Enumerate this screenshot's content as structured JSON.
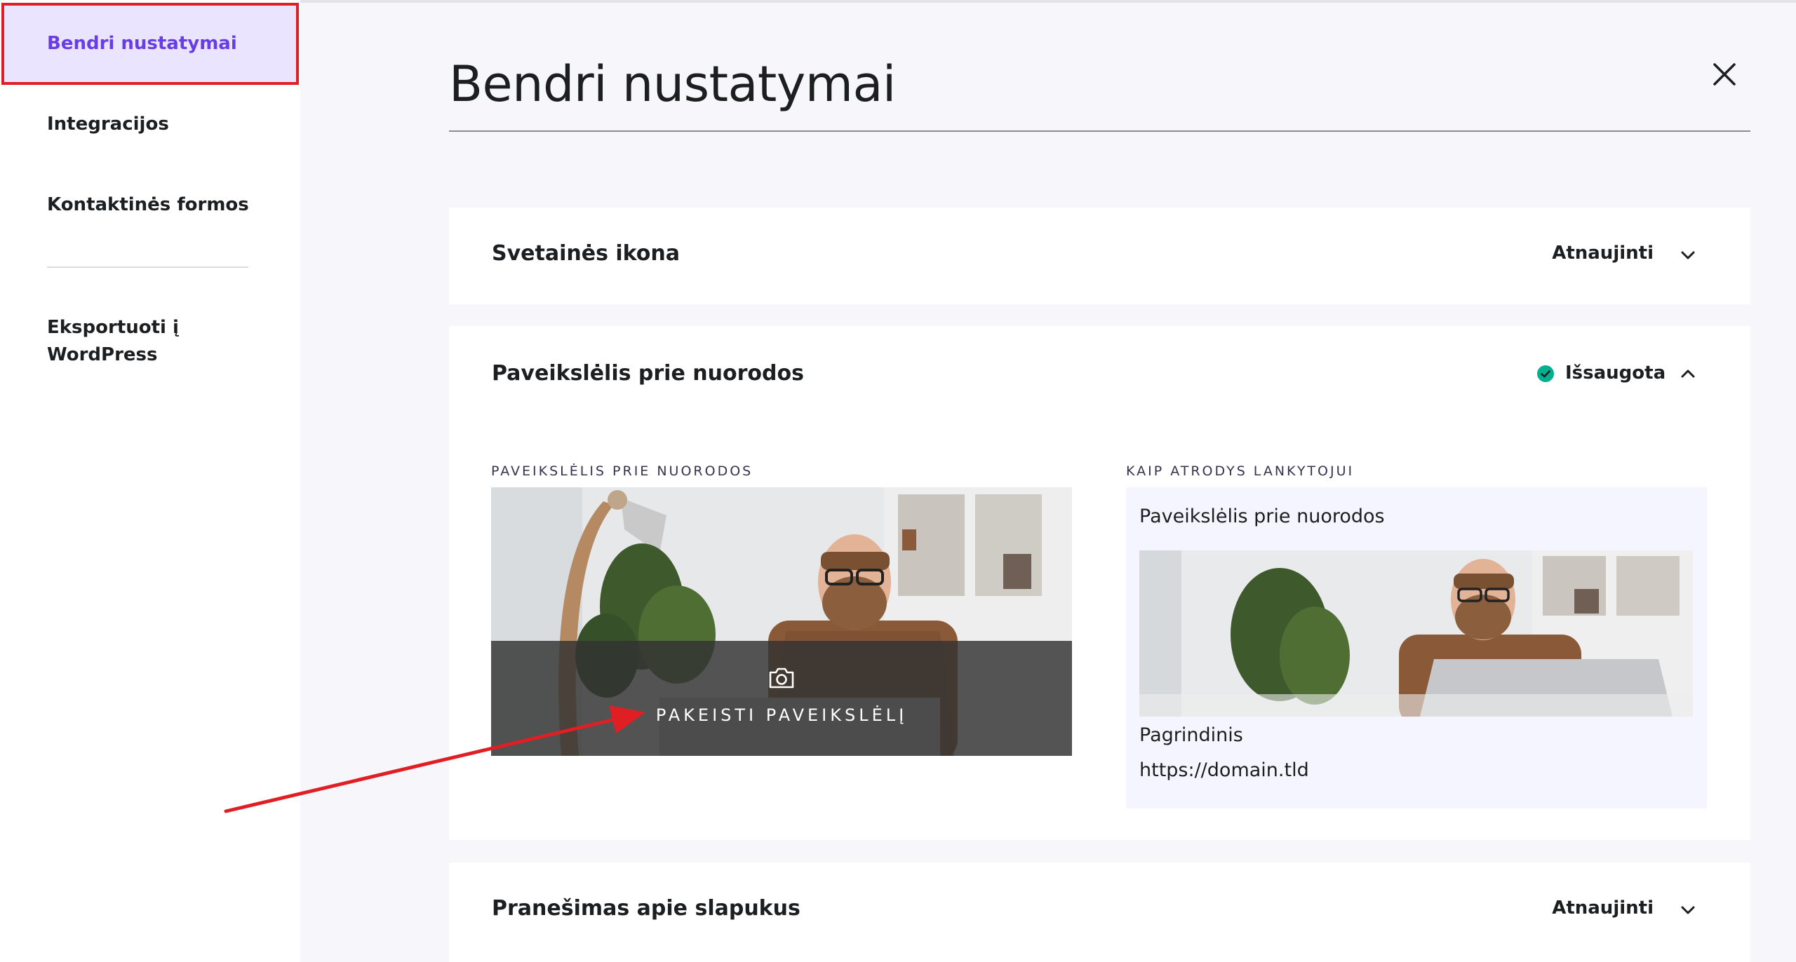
{
  "sidebar": {
    "items": [
      {
        "label": "Bendri nustatymai"
      },
      {
        "label": "Integracijos"
      },
      {
        "label": "Kontaktinės formos"
      },
      {
        "label": "Eksportuoti į"
      },
      {
        "label": "WordPress"
      }
    ]
  },
  "main": {
    "title": "Bendri nustatymai",
    "sections": {
      "site_icon": {
        "title": "Svetainės ikona",
        "action": "Atnaujinti"
      },
      "link_image": {
        "title": "Paveikslėlis prie nuorodos",
        "status": "Išsaugota",
        "image_label": "PAVEIKSLĖLIS PRIE NUORODOS",
        "change_button": "PAKEISTI PAVEIKSLĖLĮ",
        "preview_label": "KAIP ATRODYS LANKYTOJUI",
        "preview": {
          "title": "Paveikslėlis prie nuorodos",
          "name": "Pagrindinis",
          "url": "https://domain.tld"
        }
      },
      "cookies": {
        "title": "Pranešimas apie slapukus",
        "action": "Atnaujinti"
      }
    }
  },
  "colors": {
    "accent": "#673de6",
    "active_bg": "#ebe4ff",
    "highlight": "#e01f25",
    "success": "#00b090"
  }
}
